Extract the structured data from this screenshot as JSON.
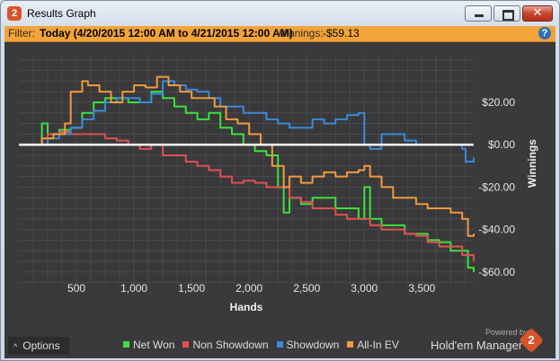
{
  "window": {
    "title": "Results Graph",
    "app_icon_text": "2",
    "controls": {
      "close_glyph": "✕"
    }
  },
  "filter_bar": {
    "label": "Filter:",
    "value": "Today (4/20/2015 12:00 AM to 4/21/2015 12:00 AM)",
    "winnings_label": "Winnings:",
    "winnings_value": "-$59.13",
    "help_glyph": "?"
  },
  "chart_data": {
    "type": "line",
    "xlabel": "Hands",
    "ylabel": "Winnings",
    "xlim": [
      0,
      3950
    ],
    "ylim": [
      -66,
      42
    ],
    "x_ticks": [
      500,
      1000,
      1500,
      2000,
      2500,
      3000,
      3500
    ],
    "x_tick_labels": [
      "500",
      "1,000",
      "1,500",
      "2,000",
      "2,500",
      "3,000",
      "3,500"
    ],
    "y_ticks": [
      20,
      0,
      -20,
      -40,
      -60
    ],
    "y_tick_labels": [
      "$20.00",
      "$0.00",
      "-$20.00",
      "-$40.00",
      "-$60.00"
    ],
    "grid": true,
    "legend_position": "bottom",
    "zero_line": true,
    "series": [
      {
        "name": "Net Won",
        "color": "#3ee03e",
        "x": [
          0,
          150,
          200,
          250,
          350,
          450,
          550,
          650,
          750,
          850,
          950,
          1050,
          1150,
          1250,
          1350,
          1450,
          1550,
          1650,
          1750,
          1850,
          1950,
          2050,
          2150,
          2250,
          2300,
          2350,
          2450,
          2550,
          2650,
          2750,
          2850,
          2950,
          3000,
          3050,
          3150,
          3250,
          3350,
          3450,
          3550,
          3650,
          3750,
          3850,
          3900,
          3950
        ],
        "y": [
          0,
          0,
          10,
          5,
          7,
          8,
          15,
          20,
          22,
          22,
          20,
          20,
          25,
          22,
          18,
          15,
          12,
          15,
          8,
          5,
          0,
          -3,
          -5,
          -20,
          -32,
          -25,
          -28,
          -25,
          -25,
          -30,
          -30,
          -35,
          -20,
          -35,
          -38,
          -38,
          -42,
          -42,
          -45,
          -46,
          -50,
          -50,
          -58,
          -60
        ]
      },
      {
        "name": "Non Showdown",
        "color": "#e05050",
        "x": [
          0,
          150,
          250,
          350,
          450,
          550,
          650,
          750,
          850,
          950,
          1050,
          1150,
          1250,
          1350,
          1450,
          1550,
          1650,
          1750,
          1850,
          1950,
          2050,
          2150,
          2250,
          2350,
          2450,
          2550,
          2650,
          2750,
          2850,
          2950,
          3050,
          3150,
          3250,
          3350,
          3450,
          3550,
          3650,
          3750,
          3850,
          3950
        ],
        "y": [
          0,
          0,
          5,
          6,
          5,
          5,
          5,
          3,
          2,
          0,
          -2,
          0,
          -5,
          -5,
          -8,
          -10,
          -12,
          -15,
          -18,
          -17,
          -18,
          -20,
          -20,
          -25,
          -27,
          -30,
          -30,
          -33,
          -35,
          -35,
          -38,
          -40,
          -40,
          -42,
          -43,
          -46,
          -48,
          -48,
          -52,
          -55
        ]
      },
      {
        "name": "Showdown",
        "color": "#3a8ad8",
        "x": [
          0,
          150,
          250,
          350,
          450,
          550,
          650,
          750,
          850,
          950,
          1050,
          1150,
          1250,
          1350,
          1450,
          1550,
          1650,
          1750,
          1850,
          1950,
          2050,
          2150,
          2250,
          2350,
          2450,
          2550,
          2650,
          2750,
          2850,
          2950,
          3000,
          3050,
          3150,
          3250,
          3350,
          3450,
          3550,
          3650,
          3750,
          3850,
          3880,
          3950
        ],
        "y": [
          0,
          0,
          3,
          5,
          8,
          12,
          16,
          20,
          22,
          22,
          20,
          24,
          30,
          28,
          26,
          25,
          22,
          18,
          18,
          15,
          15,
          12,
          10,
          8,
          8,
          12,
          10,
          12,
          14,
          15,
          0,
          -2,
          5,
          5,
          2,
          0,
          0,
          0,
          0,
          -2,
          -8,
          -6
        ]
      },
      {
        "name": "All-In EV",
        "color": "#f09a3e",
        "x": [
          0,
          150,
          200,
          300,
          400,
          450,
          550,
          600,
          700,
          800,
          900,
          1000,
          1100,
          1200,
          1300,
          1400,
          1500,
          1600,
          1700,
          1800,
          1900,
          2000,
          2100,
          2200,
          2300,
          2350,
          2450,
          2550,
          2650,
          2750,
          2850,
          2950,
          3000,
          3050,
          3150,
          3250,
          3350,
          3450,
          3550,
          3650,
          3750,
          3850,
          3900,
          3950
        ],
        "y": [
          0,
          0,
          3,
          5,
          10,
          25,
          30,
          28,
          25,
          20,
          25,
          28,
          27,
          32,
          28,
          25,
          22,
          22,
          18,
          12,
          10,
          5,
          0,
          -10,
          -20,
          -15,
          -18,
          -15,
          -13,
          -15,
          -13,
          -12,
          -10,
          -15,
          -20,
          -25,
          -25,
          -28,
          -30,
          -30,
          -32,
          -35,
          -43,
          -42
        ]
      }
    ]
  },
  "footer": {
    "options_label": "Options",
    "options_chevron": "^",
    "powered_by": "Powered by",
    "brand_name": "Hold'em Manager",
    "brand_logo_text": "2"
  }
}
